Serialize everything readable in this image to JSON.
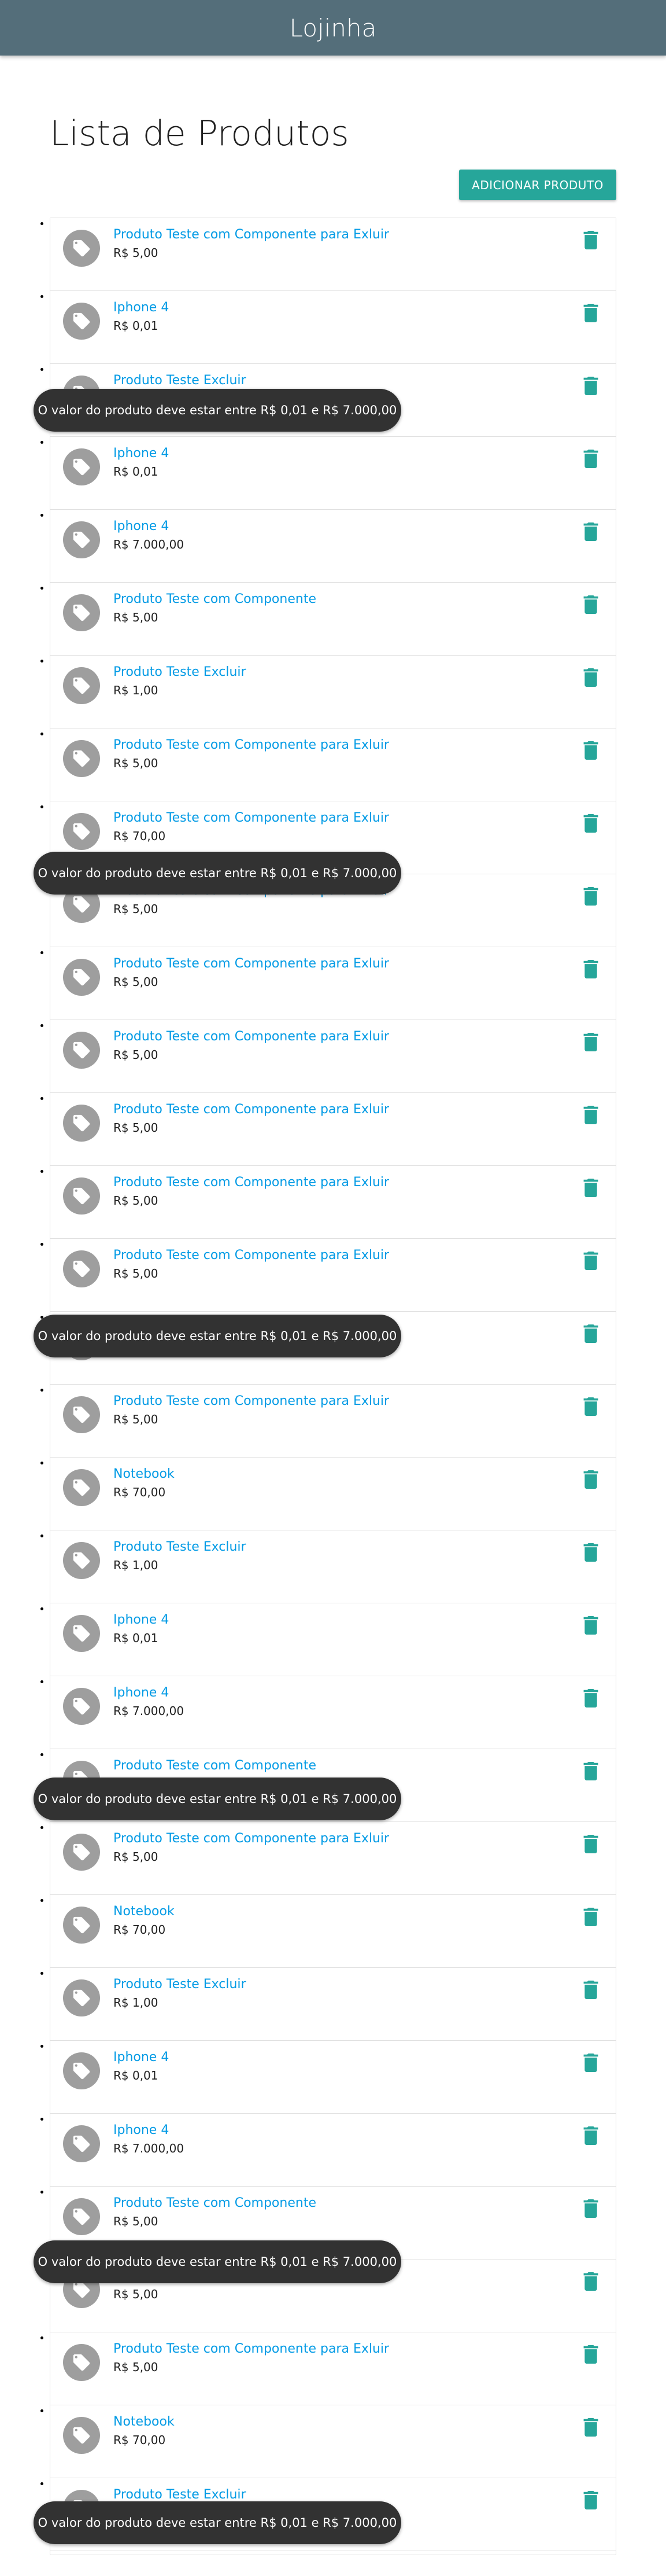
{
  "app": {
    "brand": "Lojinha"
  },
  "page": {
    "title": "Lista de Produtos",
    "add_button": "ADICIONAR PRODUTO"
  },
  "colors": {
    "navbar": "#546e7a",
    "accent": "#26a69a",
    "link": "#039be5",
    "avatar": "#9e9e9e",
    "toast": "#323232"
  },
  "icons": {
    "avatar": "tag-icon",
    "delete": "trash-icon"
  },
  "products": [
    {
      "name": "Produto Teste com Componente para Exluir",
      "price": "R$ 5,00"
    },
    {
      "name": "Iphone 4",
      "price": "R$ 0,01"
    },
    {
      "name": "Produto Teste Excluir",
      "price": ""
    },
    {
      "name": "Iphone 4",
      "price": "R$ 0,01"
    },
    {
      "name": "Iphone 4",
      "price": "R$ 7.000,00"
    },
    {
      "name": "Produto Teste com Componente",
      "price": "R$ 5,00"
    },
    {
      "name": "Produto Teste Excluir",
      "price": "R$ 1,00"
    },
    {
      "name": "Produto Teste com Componente para Exluir",
      "price": "R$ 5,00"
    },
    {
      "name": "Produto Teste com Componente para Exluir",
      "price": "R$ 70,00"
    },
    {
      "name": "Produto Teste com Componente para Exluir",
      "price": "R$ 5,00"
    },
    {
      "name": "Produto Teste com Componente para Exluir",
      "price": "R$ 5,00"
    },
    {
      "name": "Produto Teste com Componente para Exluir",
      "price": "R$ 5,00"
    },
    {
      "name": "Produto Teste com Componente para Exluir",
      "price": "R$ 5,00"
    },
    {
      "name": "Produto Teste com Componente para Exluir",
      "price": "R$ 5,00"
    },
    {
      "name": "Produto Teste com Componente para Exluir",
      "price": "R$ 5,00"
    },
    {
      "name": "",
      "price": ""
    },
    {
      "name": "Produto Teste com Componente para Exluir",
      "price": "R$ 5,00"
    },
    {
      "name": "Notebook",
      "price": "R$ 70,00"
    },
    {
      "name": "Produto Teste Excluir",
      "price": "R$ 1,00"
    },
    {
      "name": "Iphone 4",
      "price": "R$ 0,01"
    },
    {
      "name": "Iphone 4",
      "price": "R$ 7.000,00"
    },
    {
      "name": "Produto Teste com Componente",
      "price": ""
    },
    {
      "name": "Produto Teste com Componente para Exluir",
      "price": "R$ 5,00"
    },
    {
      "name": "Notebook",
      "price": "R$ 70,00"
    },
    {
      "name": "Produto Teste Excluir",
      "price": "R$ 1,00"
    },
    {
      "name": "Iphone 4",
      "price": "R$ 0,01"
    },
    {
      "name": "Iphone 4",
      "price": "R$ 7.000,00"
    },
    {
      "name": "Produto Teste com Componente",
      "price": "R$ 5,00"
    },
    {
      "name": "Produto Teste com Componente para Exluir",
      "price": "R$ 5,00"
    },
    {
      "name": "Produto Teste com Componente para Exluir",
      "price": "R$ 5,00"
    },
    {
      "name": "Notebook",
      "price": "R$ 70,00"
    },
    {
      "name": "Produto Teste Excluir",
      "price": ""
    }
  ],
  "toast_message": "O valor do produto deve estar entre R$ 0,01 e R$ 7.000,00",
  "toasts": [
    {
      "message": "O valor do produto deve estar entre R$ 0,01 e R$ 7.000,00"
    },
    {
      "message": "O valor do produto deve estar entre R$ 0,01 e R$ 7.000,00"
    },
    {
      "message": "O valor do produto deve estar entre R$ 0,01 e R$ 7.000,00"
    },
    {
      "message": "O valor do produto deve estar entre R$ 0,01 e R$ 7.000,00"
    },
    {
      "message": "O valor do produto deve estar entre R$ 0,01 e R$ 7.000,00"
    },
    {
      "message": "O valor do produto deve estar entre R$ 0,01 e R$ 7.000,00"
    }
  ]
}
